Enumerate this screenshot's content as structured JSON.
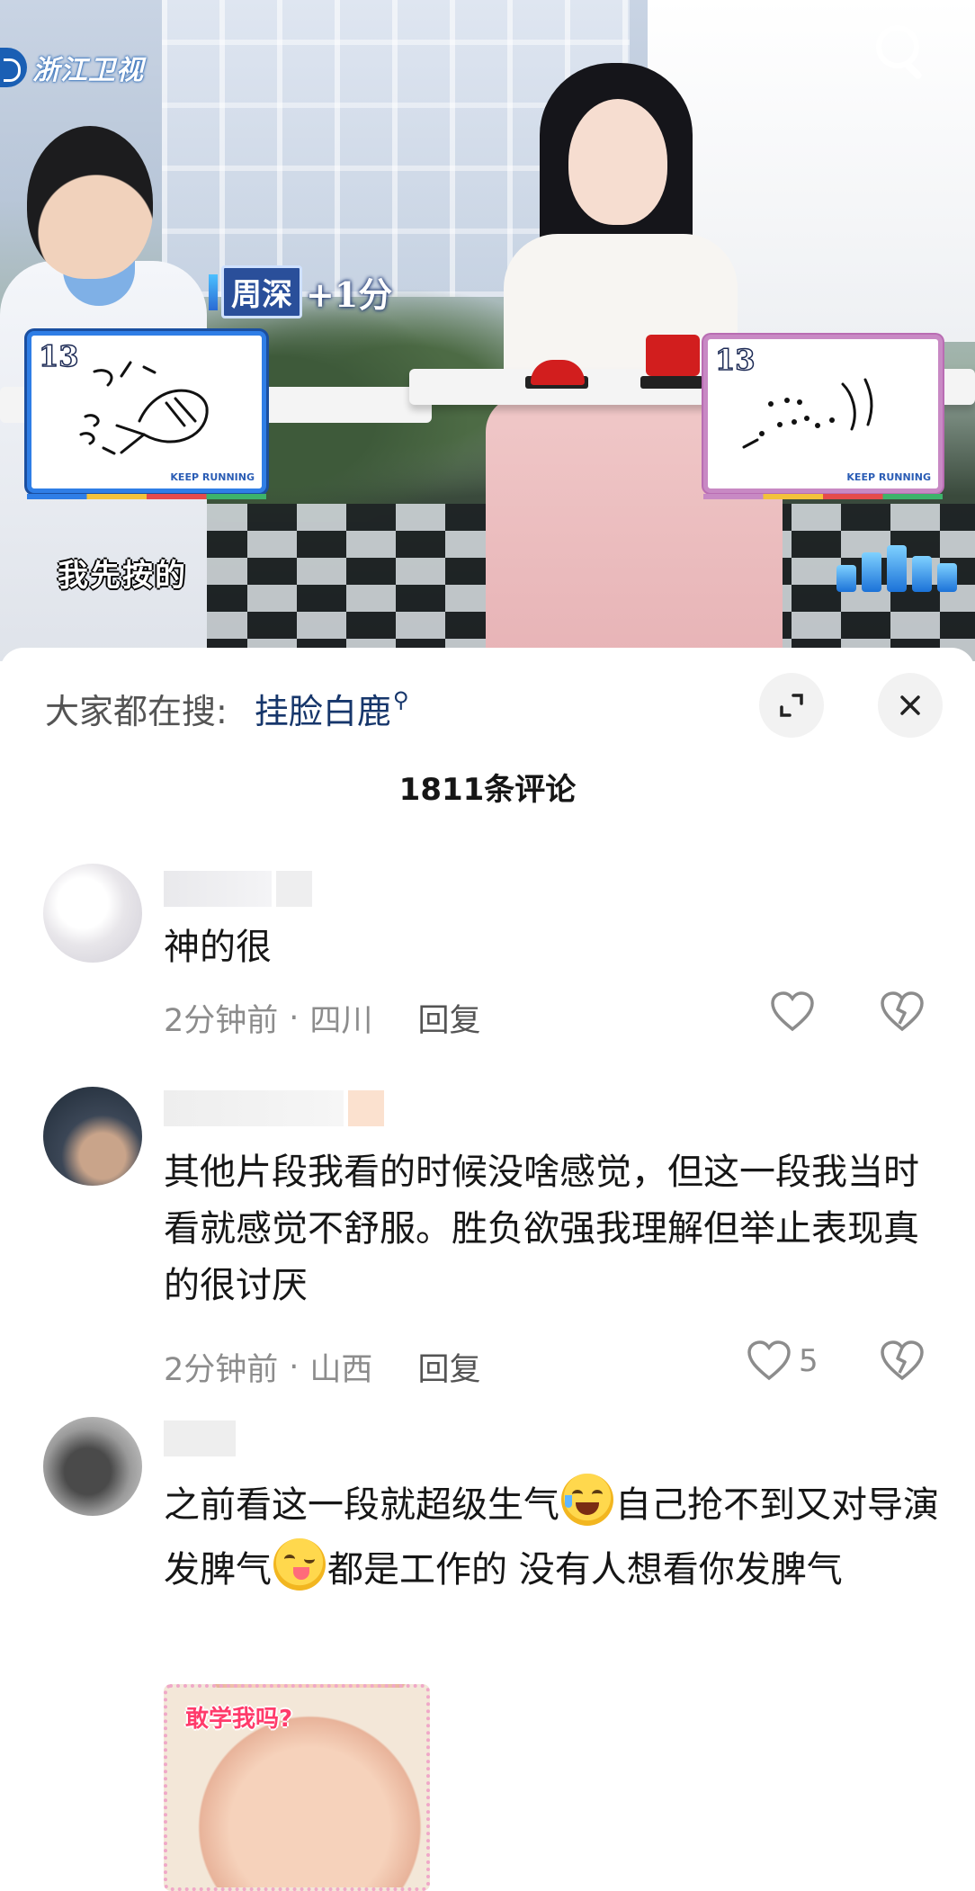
{
  "video": {
    "channel_logo": "浙江卫视",
    "score_name": "周深",
    "score_points": "+1分",
    "subtitle": "我先按的",
    "card_left_number": "13",
    "card_right_number": "13",
    "card_brand": "KEEP RUNNING",
    "icons": {
      "search": "search-icon"
    }
  },
  "sheet": {
    "search_label": "大家都在搜:",
    "search_keyword": "挂脸白鹿",
    "comment_count": "1811条评论",
    "icons": {
      "expand": "expand-icon",
      "close": "close-icon",
      "like": "heart-icon",
      "dislike": "broken-heart-icon"
    }
  },
  "comments": [
    {
      "text": "神的很",
      "time": "2分钟前",
      "sep": "·",
      "location": "四川",
      "reply": "回复",
      "likes": ""
    },
    {
      "text": "其他片段我看的时候没啥感觉，但这一段我当时看就感觉不舒服。胜负欲强我理解但举止表现真的很讨厌",
      "time": "2分钟前",
      "sep": "·",
      "location": "山西",
      "reply": "回复",
      "likes": "5"
    },
    {
      "text_part1": "之前看这一段就超级生气",
      "text_part2": "自己抢不到又对导演发脾气",
      "text_part3": "都是工作的 没有人想看你发脾气",
      "sticker_caption": "敢学我吗?"
    }
  ]
}
